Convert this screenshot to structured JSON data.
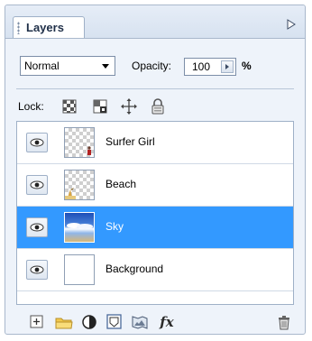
{
  "panel": {
    "tab_label": "Layers",
    "expand_icon": "triangle-right-icon"
  },
  "blend": {
    "mode": "Normal",
    "opacity_label": "Opacity:",
    "opacity_value": "100",
    "opacity_unit": "%"
  },
  "lock": {
    "label": "Lock:",
    "buttons": [
      "lock-transparent-pixels-icon",
      "lock-image-pixels-icon",
      "lock-position-icon",
      "lock-all-icon"
    ]
  },
  "layers": [
    {
      "name": "Surfer Girl",
      "visible": true,
      "selected": false,
      "thumb": "transparent"
    },
    {
      "name": "Beach",
      "visible": true,
      "selected": false,
      "thumb": "transparent"
    },
    {
      "name": "Sky",
      "visible": true,
      "selected": true,
      "thumb": "sky"
    },
    {
      "name": "Background",
      "visible": true,
      "selected": false,
      "thumb": "white"
    }
  ],
  "toolbar": {
    "buttons": [
      "new-layer-icon",
      "new-group-icon",
      "adjustment-layer-icon",
      "layer-mask-icon",
      "layer-style-icon",
      "fx-icon",
      "delete-layer-icon"
    ],
    "fx_label": "fx"
  },
  "colors": {
    "selection": "#3399ff",
    "panel_bg": "#eef3fa",
    "border": "#a9b8cc"
  }
}
